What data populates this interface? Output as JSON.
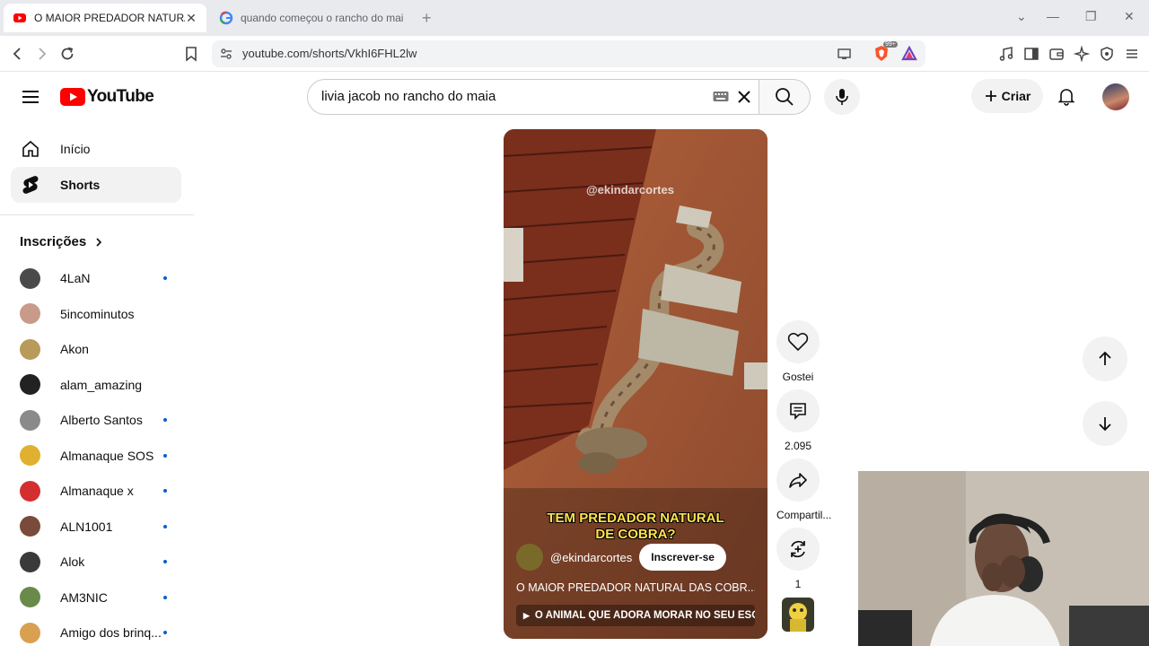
{
  "browser": {
    "tabs": [
      {
        "title": "O MAIOR PREDADOR NATURAL",
        "favicon": "youtube-favicon",
        "active": true
      },
      {
        "title": "quando começou o rancho do maia",
        "favicon": "google-favicon",
        "active": false
      }
    ],
    "url": "youtube.com/shorts/VkhI6FHL2lw",
    "shield_badge": "99+"
  },
  "header": {
    "logo_text": "YouTube",
    "search_value": "livia jacob no rancho do maia",
    "create_label": "Criar"
  },
  "sidebar": {
    "items": [
      {
        "label": "Início",
        "icon": "home-icon",
        "selected": false
      },
      {
        "label": "Shorts",
        "icon": "shorts-icon",
        "selected": true
      }
    ],
    "subscriptions_title": "Inscrições",
    "subscriptions": [
      {
        "name": "4LaN",
        "new": true,
        "color": "#4a4a4a"
      },
      {
        "name": "5incominutos",
        "new": false,
        "color": "#c89a8a"
      },
      {
        "name": "Akon",
        "new": false,
        "color": "#b89a5a"
      },
      {
        "name": "alam_amazing",
        "new": false,
        "color": "#222222"
      },
      {
        "name": "Alberto Santos",
        "new": true,
        "color": "#8a8a8a"
      },
      {
        "name": "Almanaque SOS",
        "new": true,
        "color": "#e0b030"
      },
      {
        "name": "Almanaque x",
        "new": true,
        "color": "#d32f2f"
      },
      {
        "name": "ALN1001",
        "new": true,
        "color": "#7a4a3a"
      },
      {
        "name": "Alok",
        "new": true,
        "color": "#3a3a3a"
      },
      {
        "name": "AM3NIC",
        "new": true,
        "color": "#6a8a4a"
      },
      {
        "name": "Amigo dos brinq...",
        "new": true,
        "color": "#d8a050"
      }
    ]
  },
  "short": {
    "watermark": "@ekindarcortes",
    "caption_line1": "TEM PREDADOR NATURAL",
    "caption_line2": "DE COBRA?",
    "channel": "@ekindarcortes",
    "subscribe_label": "Inscrever-se",
    "title": "O MAIOR PREDADOR NATURAL DAS COBR...",
    "linked_video": "O ANIMAL QUE ADORA MORAR NO SEU ESG..."
  },
  "actions": {
    "like_label": "Gostei",
    "comments_count": "2.095",
    "share_label": "Compartil...",
    "remix_count": "1"
  }
}
